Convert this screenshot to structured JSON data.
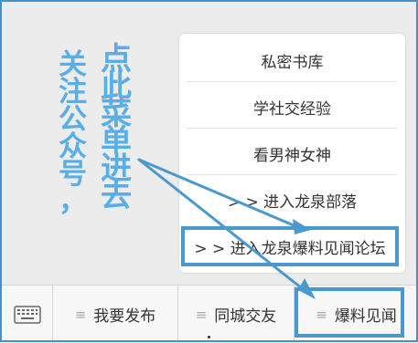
{
  "annotation": {
    "column1_chars": [
      "关",
      "注",
      "公",
      "众",
      "号",
      "，"
    ],
    "column2_chars": [
      "点",
      "此",
      "菜",
      "单",
      "进",
      "去"
    ],
    "color": "#5aaee6",
    "highlight_color": "#4a98d0"
  },
  "popup_menu": {
    "items": [
      "私密书库",
      "学社交经验",
      "看男神女神",
      "> > 进入龙泉部落"
    ],
    "highlighted_item": "> > 进入龙泉爆料见闻论坛"
  },
  "bottom_bar": {
    "keyboard_icon": "keyboard-icon",
    "tabs": [
      {
        "label": "我要发布",
        "icon": "menu-lines-icon"
      },
      {
        "label": "同城交友",
        "icon": "menu-lines-icon"
      },
      {
        "label": "爆料见闻",
        "icon": "menu-lines-icon"
      }
    ]
  }
}
